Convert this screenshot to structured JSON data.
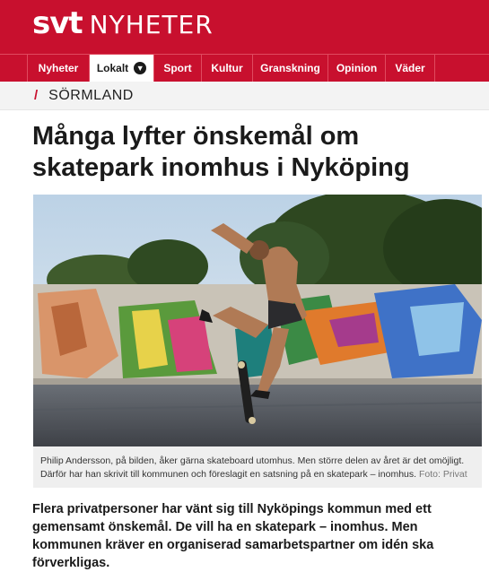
{
  "brand": {
    "logo_svt": "svt",
    "logo_section": "NYHETER",
    "color": "#c8102e"
  },
  "nav": {
    "items": [
      {
        "label": "Nyheter",
        "active": false
      },
      {
        "label": "Lokalt",
        "active": true
      },
      {
        "label": "Sport",
        "active": false
      },
      {
        "label": "Kultur",
        "active": false
      },
      {
        "label": "Granskning",
        "active": false
      },
      {
        "label": "Opinion",
        "active": false
      },
      {
        "label": "Väder",
        "active": false
      }
    ],
    "chevron_icon": "chevron-down-icon"
  },
  "region": {
    "label": "SÖRMLAND"
  },
  "article": {
    "title": "Många lyfter önskemål om skatepark inomhus i Nyköping",
    "image": {
      "icon": "photo-skateboarder-graffiti-wall"
    },
    "caption": "Philip Andersson, på bilden, åker gärna skateboard utomhus. Men större delen av året är det omöjligt. Därför har han skrivit till kommunen och föreslagit en satsning på en skatepark – inomhus.",
    "credit": "Foto: Privat",
    "lead": "Flera privatpersoner har vänt sig till Nyköpings kommun med ett gemensamt önskemål. De vill ha en skatepark – inomhus. Men kommunen kräver en organiserad samarbetspartner om idén ska förverkligas."
  }
}
